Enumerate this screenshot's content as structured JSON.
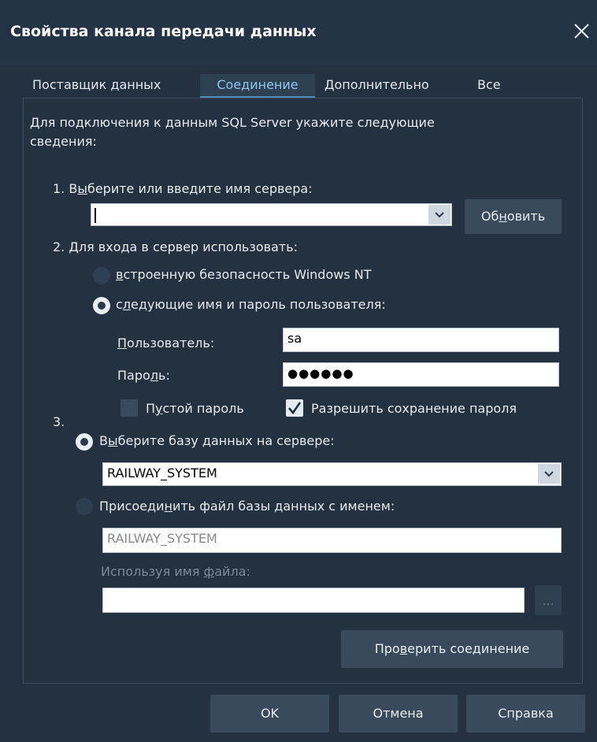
{
  "window": {
    "title": "Свойства канала передачи данных"
  },
  "tabs": [
    {
      "label": "Поставщик данных"
    },
    {
      "label": "Соединение"
    },
    {
      "label": "Дополнительно"
    },
    {
      "label": "Все"
    }
  ],
  "intro": {
    "line1": "Для подключения к данным SQL Server укажите следующие",
    "line2": "сведения:"
  },
  "server": {
    "step_label_pre": "1. В",
    "step_label_u": "ы",
    "step_label_post": "берите или введите имя сервера:",
    "value": "",
    "refresh_pre": "Об",
    "refresh_u": "н",
    "refresh_post": "овить"
  },
  "login": {
    "step_label": "2. Для входа в сервер использовать:",
    "windows_u": "в",
    "windows_rest": "строенную безопасность Windows NT",
    "userpass_pre": "с",
    "userpass_u": "л",
    "userpass_post": "едующие имя и пароль пользователя:",
    "user_label_u": "П",
    "user_label_rest": "ользователь:",
    "user_value": "sa",
    "pass_label_pre": "Паро",
    "pass_label_u": "л",
    "pass_label_post": "ь:",
    "pass_value": "●●●●●●",
    "blank_pre": "П",
    "blank_u": "у",
    "blank_post": "стой пароль",
    "allow_save": "Разрешить сохранение пароля"
  },
  "database": {
    "step_number": "3.",
    "select_pre": "В",
    "select_u": "ы",
    "select_post": "берите базу данных на сервере:",
    "selected": "RAILWAY_SYSTEM",
    "attach_pre": "Присоеди",
    "attach_u": "н",
    "attach_post": "ить файл базы данных с именем:",
    "attach_value": "RAILWAY_SYSTEM",
    "filename_pre": "Используя имя ",
    "filename_u": "ф",
    "filename_post": "айла:",
    "filename_value": "",
    "browse_label": "..."
  },
  "test": {
    "pre": "Про",
    "u": "в",
    "post": "ерить соединение"
  },
  "footer": {
    "ok": "OK",
    "cancel": "Отмена",
    "help": "Справка"
  }
}
